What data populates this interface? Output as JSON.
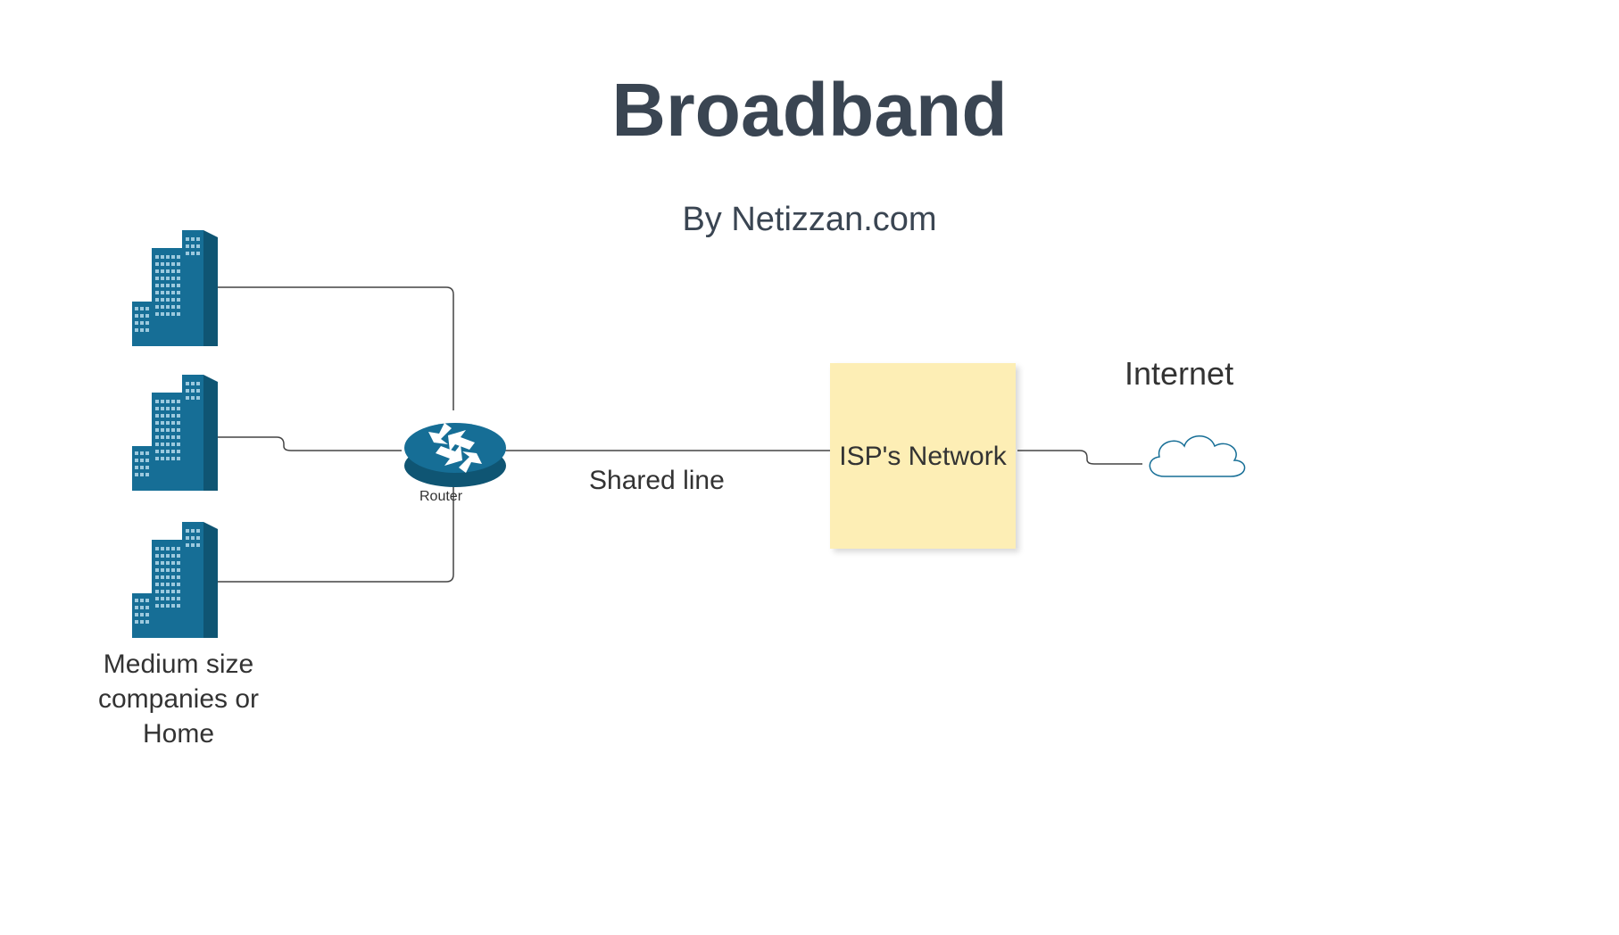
{
  "title": "Broadband",
  "subtitle": "By Netizzan.com",
  "router_label": "Router",
  "shared_line_label": "Shared line",
  "isp_label": "ISP's Network",
  "internet_label": "Internet",
  "buildings_label": "Medium size companies or Home",
  "colors": {
    "title": "#3a4552",
    "accent": "#166e96",
    "note_bg": "#fdeeb5",
    "line": "#444444"
  }
}
